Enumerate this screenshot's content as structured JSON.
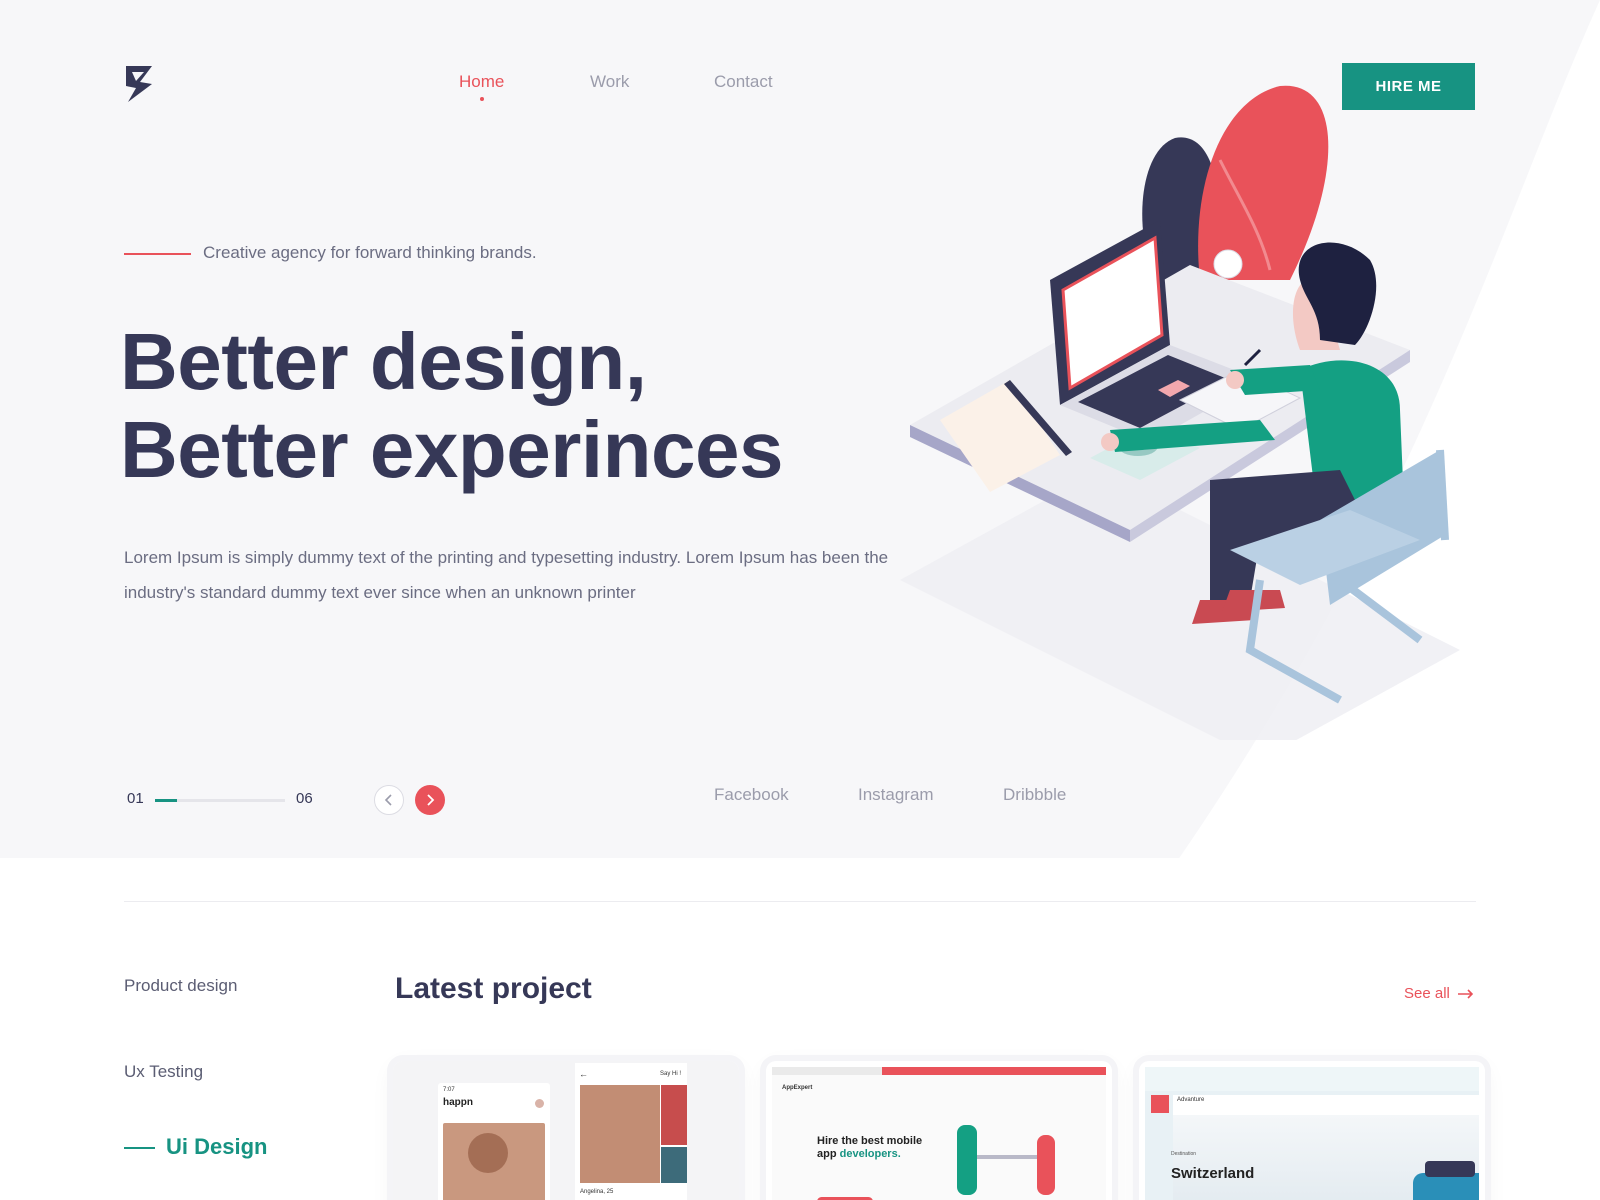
{
  "header": {
    "logo_icon": "logo-mark",
    "nav": [
      {
        "label": "Home",
        "active": true
      },
      {
        "label": "Work",
        "active": false
      },
      {
        "label": "Contact",
        "active": false
      }
    ],
    "hire_label": "HIRE ME"
  },
  "hero": {
    "tagline": "Creative agency for forward thinking brands.",
    "headline_line1": "Better design,",
    "headline_line2": "Better experinces",
    "description": "Lorem Ipsum is simply dummy text of the printing and typesetting industry. Lorem Ipsum has been the industry's standard dummy text ever since when an unknown printer",
    "slider": {
      "current": "01",
      "total": "06",
      "progress": 0.17
    },
    "social": [
      "Facebook",
      "Instagram",
      "Dribbble"
    ]
  },
  "projects": {
    "categories": [
      {
        "label": "Product design",
        "active": false
      },
      {
        "label": "Ux Testing",
        "active": false
      },
      {
        "label": "Ui Design",
        "active": true
      }
    ],
    "title": "Latest project",
    "see_all": "See all",
    "cards": [
      {
        "app_name": "happn",
        "time": "7:07",
        "say_hi": "Say Hi !",
        "person": "Angelina, 25"
      },
      {
        "brand": "AppExpert",
        "heading_line1": "Hire the best mobile",
        "heading_line2_a": "app ",
        "heading_line2_b": "developers."
      },
      {
        "brand": "Advanture",
        "label": "Destination",
        "place": "Switzerland"
      }
    ]
  },
  "colors": {
    "accent_red": "#e9525a",
    "accent_teal": "#179382",
    "text_dark": "#363857",
    "text_muted": "#6b6d82"
  }
}
